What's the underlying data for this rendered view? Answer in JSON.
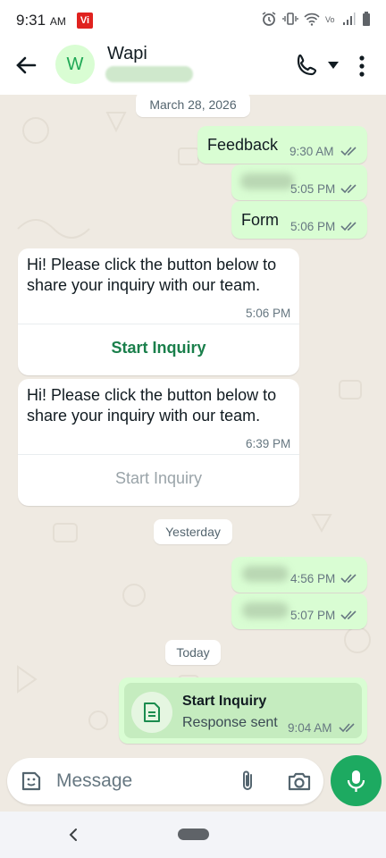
{
  "status_bar": {
    "time": "9:31",
    "ampm": "AM",
    "carrier_badge": "Vi"
  },
  "header": {
    "contact_name": "Wapi",
    "avatar_initial": "W"
  },
  "chat": {
    "date_chips": [
      "March 28, 2026",
      "Yesterday",
      "Today"
    ],
    "messages": [
      {
        "direction": "out",
        "text": "Feedback",
        "time": "9:30 AM",
        "status": "read"
      },
      {
        "direction": "out",
        "text": "",
        "time": "5:05 PM",
        "status": "read",
        "blurred": true
      },
      {
        "direction": "out",
        "text": "Form",
        "time": "5:06 PM",
        "status": "read"
      },
      {
        "direction": "in",
        "text": "Hi! Please click the button below to share your inquiry with our team.",
        "time": "5:06 PM",
        "button": "Start Inquiry",
        "button_active": true
      },
      {
        "direction": "in",
        "text": "Hi! Please click the button below to share your inquiry with our team.",
        "time": "6:39 PM",
        "button": "Start Inquiry",
        "button_active": false
      },
      {
        "direction": "out",
        "text": "",
        "time": "4:56 PM",
        "status": "read",
        "blurred": true
      },
      {
        "direction": "out",
        "text": "",
        "time": "5:07 PM",
        "status": "read",
        "blurred": true
      },
      {
        "direction": "out",
        "type": "form_response",
        "title": "Start Inquiry",
        "subtitle": "Response sent",
        "time": "9:04 AM",
        "status": "read"
      }
    ]
  },
  "composer": {
    "placeholder": "Message"
  },
  "colors": {
    "outgoing_bubble": "#d9fdd3",
    "incoming_bubble": "#ffffff",
    "accent": "#1daa61",
    "read_ticks": "#667781",
    "button_text": "#1a7f4b"
  }
}
